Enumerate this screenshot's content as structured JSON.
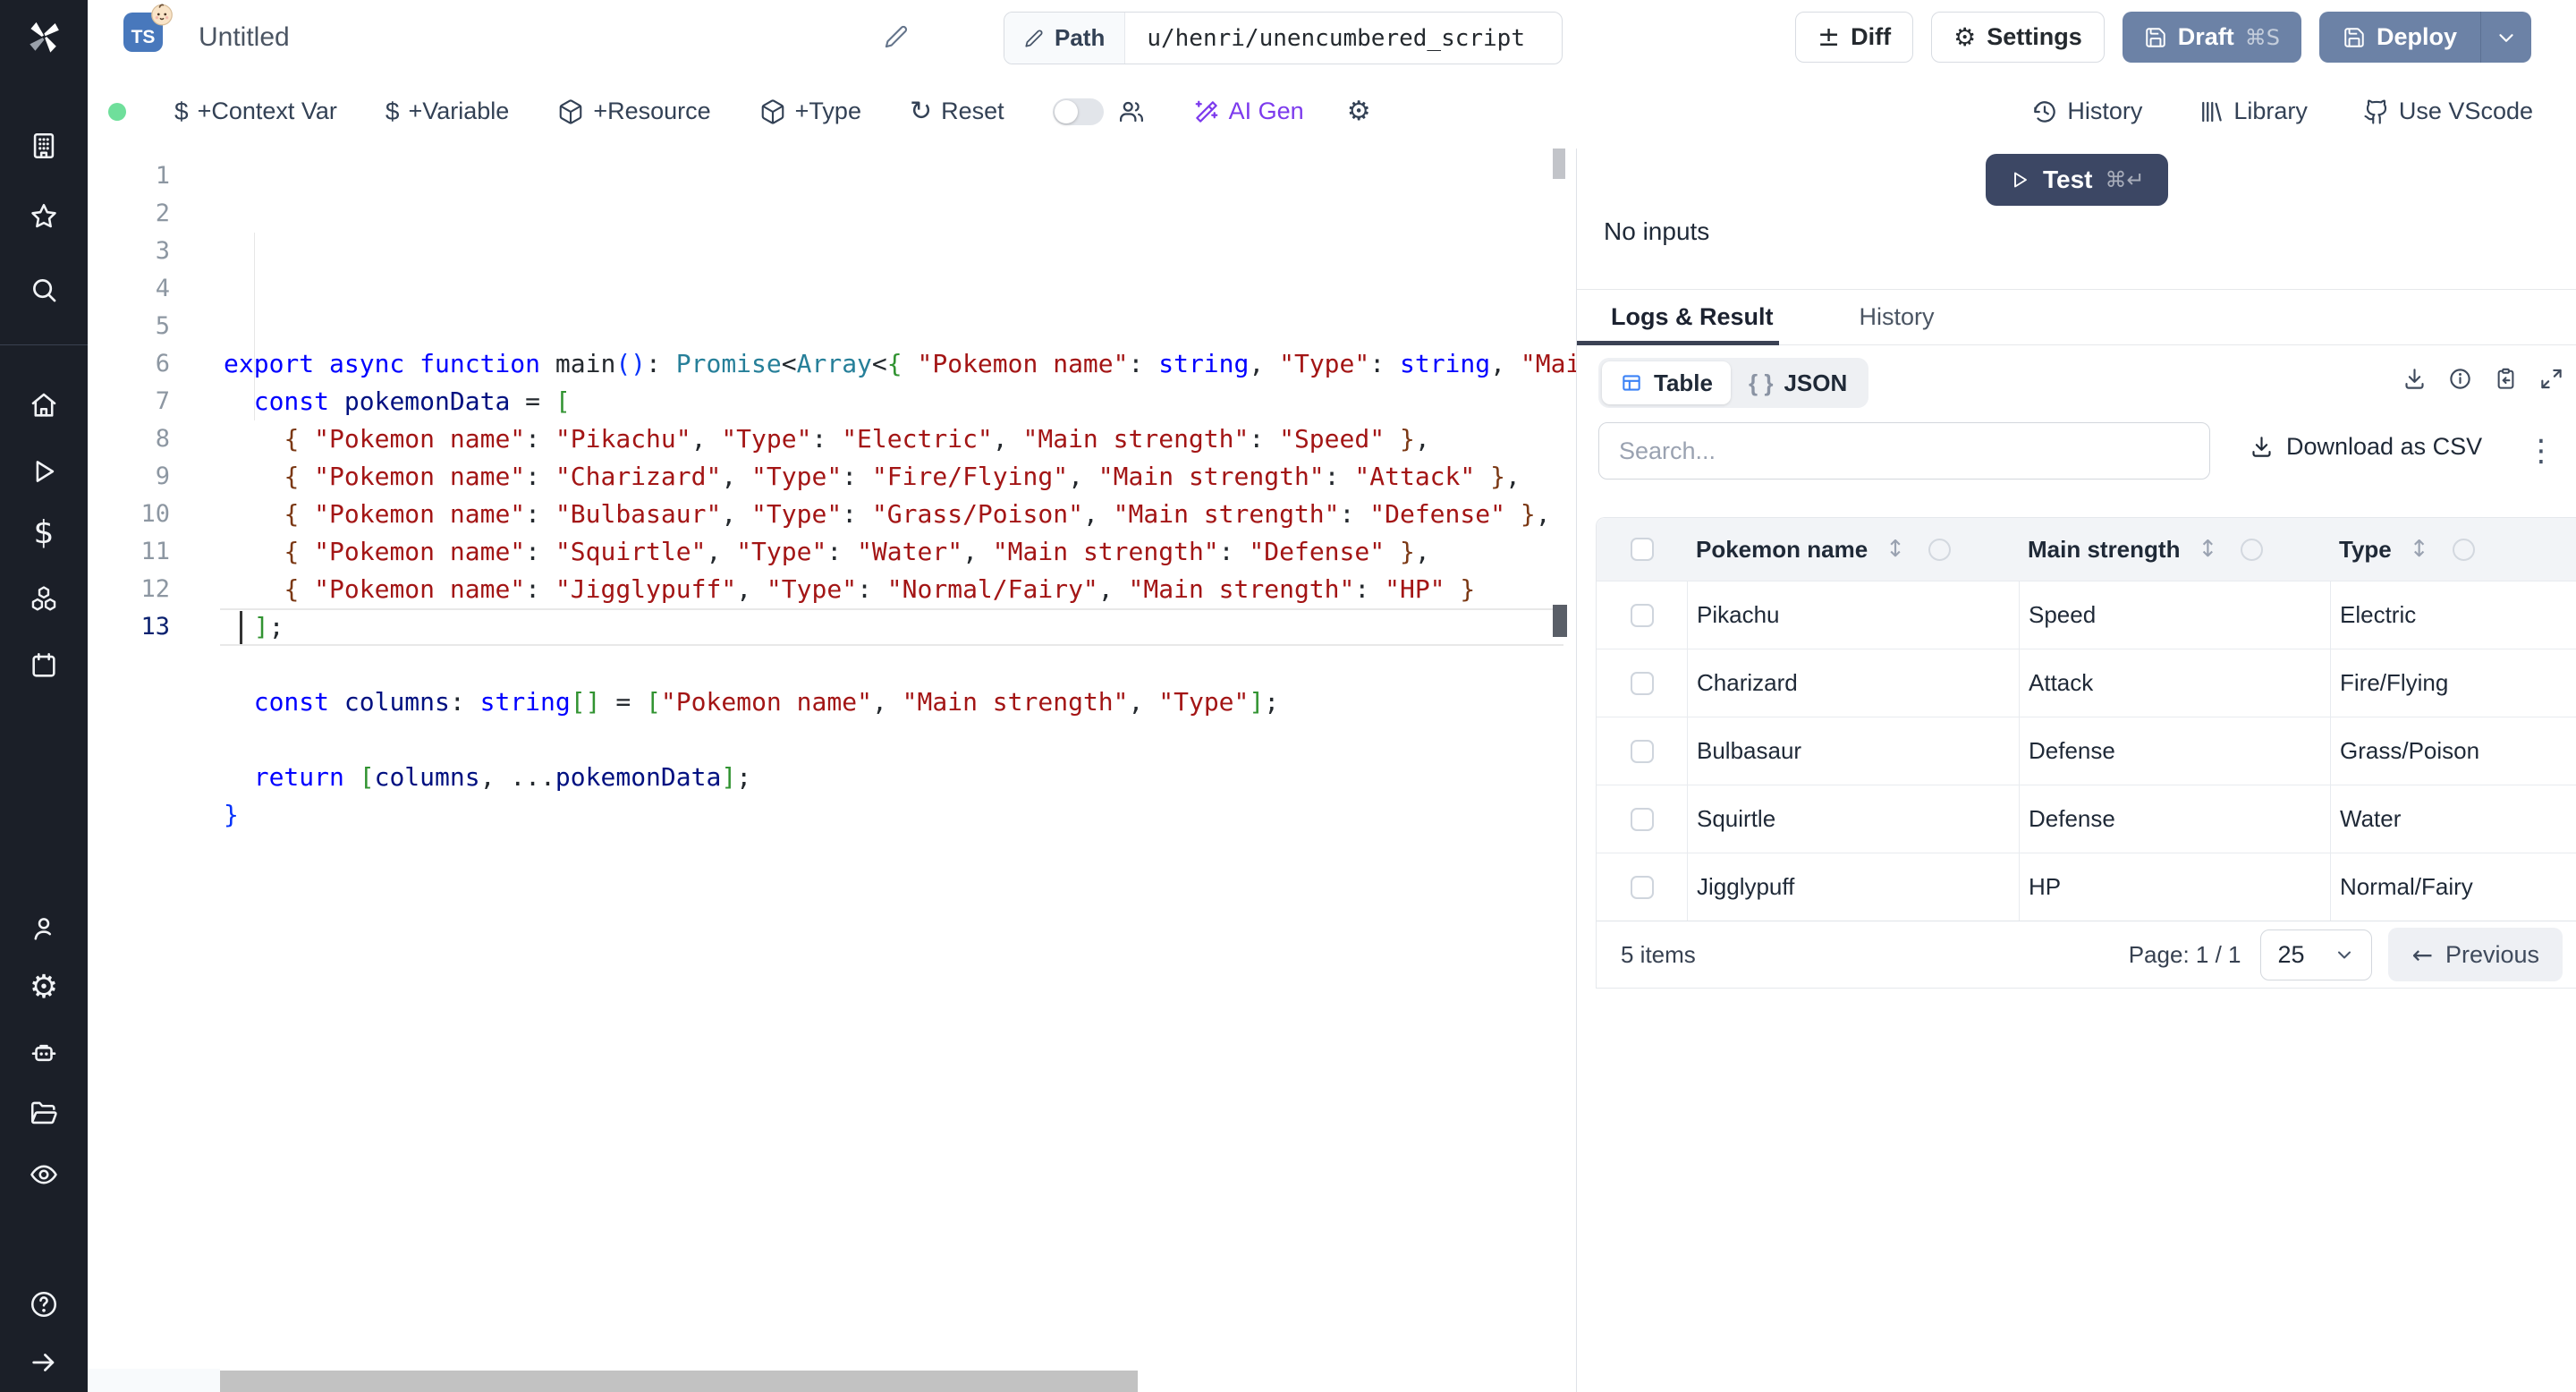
{
  "colors": {
    "sidebar_bg": "#1b1f28",
    "primary_dark": "#3c4764",
    "deploy_blue": "#6c82a6",
    "ai_purple": "#7c3aed",
    "accent_blue": "#3b82f6",
    "status_green": "#6fdf9b"
  },
  "topbar": {
    "file_type": "TS",
    "title": "Untitled",
    "path_label": "Path",
    "path_value": "u/henri/unencumbered_script",
    "diff": "Diff",
    "settings": "Settings",
    "draft": "Draft",
    "draft_kbd": "⌘S",
    "deploy": "Deploy"
  },
  "toolbar": {
    "context_var": "+Context Var",
    "variable": "+Variable",
    "resource": "+Resource",
    "type": "+Type",
    "reset": "Reset",
    "ai_gen": "AI Gen",
    "history": "History",
    "library": "Library",
    "vscode": "Use VScode"
  },
  "sidebar": {
    "items": [
      "windmill-logo",
      "building-icon",
      "star-icon",
      "search-icon",
      "home-icon",
      "play-icon",
      "dollar-icon",
      "boxes-icon",
      "calendar-icon",
      "user-icon",
      "gear-icon",
      "bot-icon",
      "folder-icon",
      "eye-icon",
      "help-icon",
      "arrow-right-icon"
    ]
  },
  "run": {
    "test": "Test",
    "test_kbd": "⌘↵",
    "no_inputs": "No inputs",
    "tab_logs": "Logs & Result",
    "tab_history": "History"
  },
  "result": {
    "view_table": "Table",
    "view_json": "JSON",
    "search_placeholder": "Search...",
    "download_csv": "Download as CSV",
    "table": {
      "headers": [
        "Pokemon name",
        "Main strength",
        "Type"
      ],
      "rows": [
        [
          "Pikachu",
          "Speed",
          "Electric"
        ],
        [
          "Charizard",
          "Attack",
          "Fire/Flying"
        ],
        [
          "Bulbasaur",
          "Defense",
          "Grass/Poison"
        ],
        [
          "Squirtle",
          "Defense",
          "Water"
        ],
        [
          "Jigglypuff",
          "HP",
          "Normal/Fairy"
        ]
      ]
    },
    "footer": {
      "items": "5 items",
      "page": "Page: 1 / 1",
      "page_size": "25",
      "previous": "Previous"
    }
  },
  "editor": {
    "lines": [
      {
        "num": 1,
        "tokens": [
          {
            "t": "export async function ",
            "s": "kw"
          },
          {
            "t": "main",
            "s": "fn"
          },
          {
            "t": "()",
            "s": "b1"
          },
          {
            "t": ": ",
            "s": "pl"
          },
          {
            "t": "Promise",
            "s": "ty"
          },
          {
            "t": "<",
            "s": "pl"
          },
          {
            "t": "Array",
            "s": "ty"
          },
          {
            "t": "<",
            "s": "pl"
          },
          {
            "t": "{ ",
            "s": "b2"
          },
          {
            "t": "\"Pokemon name\"",
            "s": "str"
          },
          {
            "t": ": ",
            "s": "pl"
          },
          {
            "t": "string",
            "s": "kw"
          },
          {
            "t": ", ",
            "s": "pl"
          },
          {
            "t": "\"Type\"",
            "s": "str"
          },
          {
            "t": ": ",
            "s": "pl"
          },
          {
            "t": "string",
            "s": "kw"
          },
          {
            "t": ", ",
            "s": "pl"
          },
          {
            "t": "\"Mai",
            "s": "str"
          }
        ]
      },
      {
        "num": 2,
        "tokens": [
          {
            "t": "  ",
            "s": "pl"
          },
          {
            "t": "const",
            "s": "kw"
          },
          {
            "t": " ",
            "s": "pl"
          },
          {
            "t": "pokemonData",
            "s": "var"
          },
          {
            "t": " = ",
            "s": "pl"
          },
          {
            "t": "[",
            "s": "b2"
          }
        ]
      },
      {
        "num": 3,
        "tokens": [
          {
            "t": "    ",
            "s": "pl"
          },
          {
            "t": "{",
            "s": "b3"
          },
          {
            "t": " ",
            "s": "pl"
          },
          {
            "t": "\"Pokemon name\"",
            "s": "str"
          },
          {
            "t": ": ",
            "s": "pl"
          },
          {
            "t": "\"Pikachu\"",
            "s": "str"
          },
          {
            "t": ", ",
            "s": "pl"
          },
          {
            "t": "\"Type\"",
            "s": "str"
          },
          {
            "t": ": ",
            "s": "pl"
          },
          {
            "t": "\"Electric\"",
            "s": "str"
          },
          {
            "t": ", ",
            "s": "pl"
          },
          {
            "t": "\"Main strength\"",
            "s": "str"
          },
          {
            "t": ": ",
            "s": "pl"
          },
          {
            "t": "\"Speed\"",
            "s": "str"
          },
          {
            "t": " ",
            "s": "pl"
          },
          {
            "t": "}",
            "s": "b3"
          },
          {
            "t": ",",
            "s": "pl"
          }
        ]
      },
      {
        "num": 4,
        "tokens": [
          {
            "t": "    ",
            "s": "pl"
          },
          {
            "t": "{",
            "s": "b3"
          },
          {
            "t": " ",
            "s": "pl"
          },
          {
            "t": "\"Pokemon name\"",
            "s": "str"
          },
          {
            "t": ": ",
            "s": "pl"
          },
          {
            "t": "\"Charizard\"",
            "s": "str"
          },
          {
            "t": ", ",
            "s": "pl"
          },
          {
            "t": "\"Type\"",
            "s": "str"
          },
          {
            "t": ": ",
            "s": "pl"
          },
          {
            "t": "\"Fire/Flying\"",
            "s": "str"
          },
          {
            "t": ", ",
            "s": "pl"
          },
          {
            "t": "\"Main strength\"",
            "s": "str"
          },
          {
            "t": ": ",
            "s": "pl"
          },
          {
            "t": "\"Attack\"",
            "s": "str"
          },
          {
            "t": " ",
            "s": "pl"
          },
          {
            "t": "}",
            "s": "b3"
          },
          {
            "t": ",",
            "s": "pl"
          }
        ]
      },
      {
        "num": 5,
        "tokens": [
          {
            "t": "    ",
            "s": "pl"
          },
          {
            "t": "{",
            "s": "b3"
          },
          {
            "t": " ",
            "s": "pl"
          },
          {
            "t": "\"Pokemon name\"",
            "s": "str"
          },
          {
            "t": ": ",
            "s": "pl"
          },
          {
            "t": "\"Bulbasaur\"",
            "s": "str"
          },
          {
            "t": ", ",
            "s": "pl"
          },
          {
            "t": "\"Type\"",
            "s": "str"
          },
          {
            "t": ": ",
            "s": "pl"
          },
          {
            "t": "\"Grass/Poison\"",
            "s": "str"
          },
          {
            "t": ", ",
            "s": "pl"
          },
          {
            "t": "\"Main strength\"",
            "s": "str"
          },
          {
            "t": ": ",
            "s": "pl"
          },
          {
            "t": "\"Defense\"",
            "s": "str"
          },
          {
            "t": " ",
            "s": "pl"
          },
          {
            "t": "}",
            "s": "b3"
          },
          {
            "t": ",",
            "s": "pl"
          }
        ]
      },
      {
        "num": 6,
        "tokens": [
          {
            "t": "    ",
            "s": "pl"
          },
          {
            "t": "{",
            "s": "b3"
          },
          {
            "t": " ",
            "s": "pl"
          },
          {
            "t": "\"Pokemon name\"",
            "s": "str"
          },
          {
            "t": ": ",
            "s": "pl"
          },
          {
            "t": "\"Squirtle\"",
            "s": "str"
          },
          {
            "t": ", ",
            "s": "pl"
          },
          {
            "t": "\"Type\"",
            "s": "str"
          },
          {
            "t": ": ",
            "s": "pl"
          },
          {
            "t": "\"Water\"",
            "s": "str"
          },
          {
            "t": ", ",
            "s": "pl"
          },
          {
            "t": "\"Main strength\"",
            "s": "str"
          },
          {
            "t": ": ",
            "s": "pl"
          },
          {
            "t": "\"Defense\"",
            "s": "str"
          },
          {
            "t": " ",
            "s": "pl"
          },
          {
            "t": "}",
            "s": "b3"
          },
          {
            "t": ",",
            "s": "pl"
          }
        ]
      },
      {
        "num": 7,
        "tokens": [
          {
            "t": "    ",
            "s": "pl"
          },
          {
            "t": "{",
            "s": "b3"
          },
          {
            "t": " ",
            "s": "pl"
          },
          {
            "t": "\"Pokemon name\"",
            "s": "str"
          },
          {
            "t": ": ",
            "s": "pl"
          },
          {
            "t": "\"Jigglypuff\"",
            "s": "str"
          },
          {
            "t": ", ",
            "s": "pl"
          },
          {
            "t": "\"Type\"",
            "s": "str"
          },
          {
            "t": ": ",
            "s": "pl"
          },
          {
            "t": "\"Normal/Fairy\"",
            "s": "str"
          },
          {
            "t": ", ",
            "s": "pl"
          },
          {
            "t": "\"Main strength\"",
            "s": "str"
          },
          {
            "t": ": ",
            "s": "pl"
          },
          {
            "t": "\"HP\"",
            "s": "str"
          },
          {
            "t": " ",
            "s": "pl"
          },
          {
            "t": "}",
            "s": "b3"
          }
        ]
      },
      {
        "num": 8,
        "tokens": [
          {
            "t": "  ",
            "s": "pl"
          },
          {
            "t": "]",
            "s": "b2"
          },
          {
            "t": ";",
            "s": "pl"
          }
        ]
      },
      {
        "num": 9,
        "tokens": []
      },
      {
        "num": 10,
        "tokens": [
          {
            "t": "  ",
            "s": "pl"
          },
          {
            "t": "const",
            "s": "kw"
          },
          {
            "t": " ",
            "s": "pl"
          },
          {
            "t": "columns",
            "s": "var"
          },
          {
            "t": ": ",
            "s": "pl"
          },
          {
            "t": "string",
            "s": "kw"
          },
          {
            "t": "[]",
            "s": "b2"
          },
          {
            "t": " = ",
            "s": "pl"
          },
          {
            "t": "[",
            "s": "b2"
          },
          {
            "t": "\"Pokemon name\"",
            "s": "str"
          },
          {
            "t": ", ",
            "s": "pl"
          },
          {
            "t": "\"Main strength\"",
            "s": "str"
          },
          {
            "t": ", ",
            "s": "pl"
          },
          {
            "t": "\"Type\"",
            "s": "str"
          },
          {
            "t": "]",
            "s": "b2"
          },
          {
            "t": ";",
            "s": "pl"
          }
        ]
      },
      {
        "num": 11,
        "tokens": []
      },
      {
        "num": 12,
        "tokens": [
          {
            "t": "  ",
            "s": "pl"
          },
          {
            "t": "return",
            "s": "kw"
          },
          {
            "t": " ",
            "s": "pl"
          },
          {
            "t": "[",
            "s": "b2"
          },
          {
            "t": "columns",
            "s": "var"
          },
          {
            "t": ", ...",
            "s": "pl"
          },
          {
            "t": "pokemonData",
            "s": "var"
          },
          {
            "t": "]",
            "s": "b2"
          },
          {
            "t": ";",
            "s": "pl"
          }
        ]
      },
      {
        "num": 13,
        "active": true,
        "tokens": [
          {
            "t": "}",
            "s": "b1"
          }
        ]
      }
    ]
  }
}
